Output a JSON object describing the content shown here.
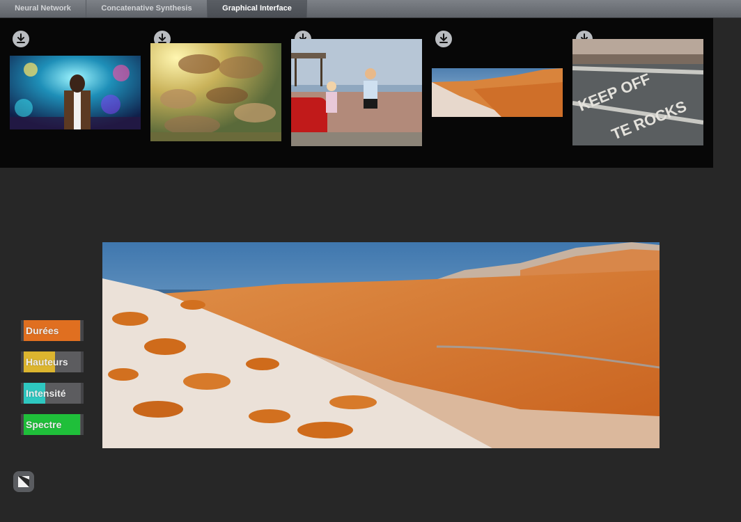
{
  "tabs": [
    {
      "label": "Neural Network"
    },
    {
      "label": "Concatenative Synthesis"
    },
    {
      "label": "Graphical Interface"
    }
  ],
  "gallery": {
    "items": [
      {
        "name": "neon-carousel-portrait"
      },
      {
        "name": "baroque-ceiling-painting"
      },
      {
        "name": "children-on-promenade"
      },
      {
        "name": "orange-hillside-panorama"
      },
      {
        "name": "keep-off-the-rocks-road"
      }
    ],
    "road_text_line1": "KEEP OFF",
    "road_text_line2": "TE ROCKS"
  },
  "params": [
    {
      "label": "Durées",
      "level": 0.9,
      "color": "#e06f20"
    },
    {
      "label": "Hauteurs",
      "level": 0.5,
      "color": "#dcb52f"
    },
    {
      "label": "Intensité",
      "level": 0.35,
      "color": "#2ec7c0"
    },
    {
      "label": "Spectre",
      "level": 0.9,
      "color": "#1fbf3a"
    }
  ],
  "icons": {
    "download": "download-icon",
    "logo": "app-logo-icon"
  }
}
